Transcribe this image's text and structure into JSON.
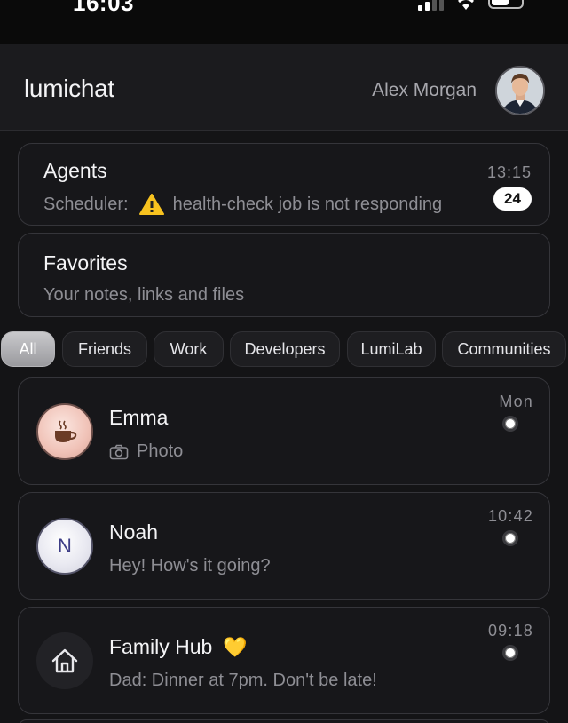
{
  "status_bar": {
    "time": "16:03"
  },
  "header": {
    "app_title": "lumichat",
    "user_name": "Alex Morgan"
  },
  "agents": {
    "title": "Agents",
    "time": "13:15",
    "sender": "Scheduler:",
    "message": "health-check job is not responding",
    "unread_count": "24"
  },
  "favorites": {
    "title": "Favorites",
    "subtitle": "Your notes, links and files"
  },
  "filters": [
    "All",
    "Friends",
    "Work",
    "Developers",
    "LumiLab",
    "Communities"
  ],
  "chats": [
    {
      "name": "Emma",
      "time": "Mon",
      "preview": "Photo",
      "avatar_icon": "coffee-cup-icon"
    },
    {
      "name": "Noah",
      "time": "10:42",
      "preview": "Hey! How's it going?",
      "initial": "N"
    },
    {
      "name": "Family Hub",
      "time": "09:18",
      "preview": "Dad: Dinner at 7pm. Don't be late!",
      "avatar_icon": "house-icon",
      "emoji": "💛"
    }
  ],
  "colors": {
    "background": "#141416",
    "card": "#17171a",
    "muted_text": "#8e8e94",
    "warning": "#f7c21f"
  }
}
